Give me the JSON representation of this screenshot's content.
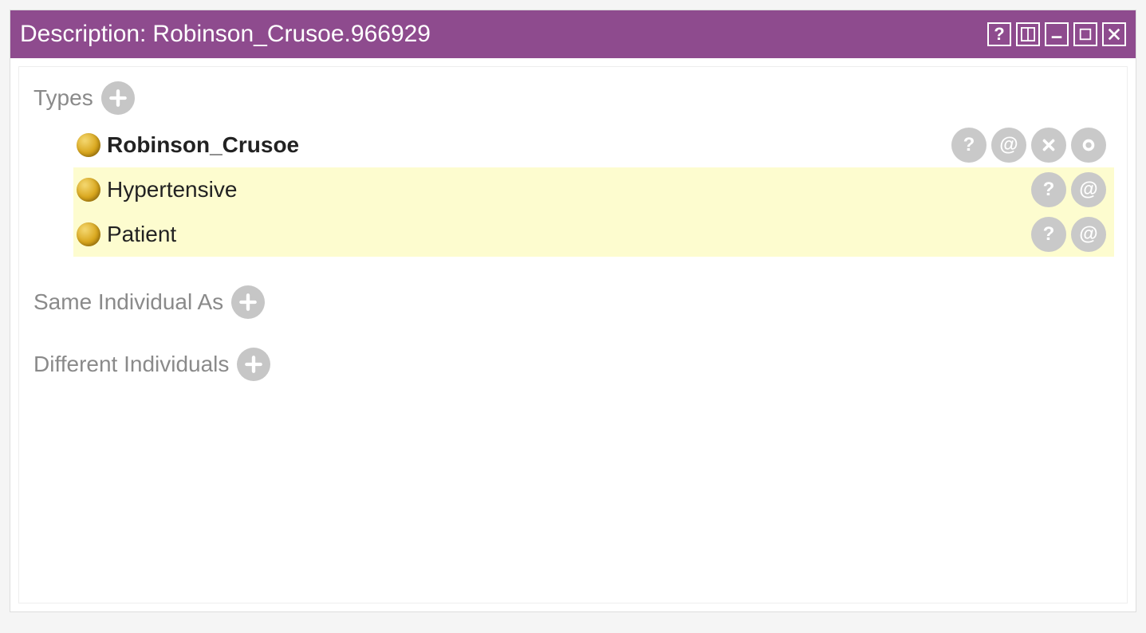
{
  "window": {
    "title_prefix": "Description:",
    "title_entity": "Robinson_Crusoe.966929"
  },
  "sections": {
    "types_label": "Types",
    "same_as_label": "Same Individual As",
    "different_label": "Different Individuals"
  },
  "types": [
    {
      "name": "Robinson_Crusoe",
      "bold": true,
      "inferred": false,
      "actions": [
        "explain",
        "at",
        "delete",
        "ring"
      ]
    },
    {
      "name": "Hypertensive",
      "bold": false,
      "inferred": true,
      "actions": [
        "explain",
        "at"
      ]
    },
    {
      "name": "Patient",
      "bold": false,
      "inferred": true,
      "actions": [
        "explain",
        "at"
      ]
    }
  ],
  "icons": {
    "explain": "?",
    "at": "@",
    "delete": "×",
    "ring": "○"
  },
  "colors": {
    "titlebar_bg": "#8e4b8e",
    "inferred_bg": "#fdfccf",
    "class_dot": "#d9a71e",
    "action_btn": "#c9c9c9"
  }
}
